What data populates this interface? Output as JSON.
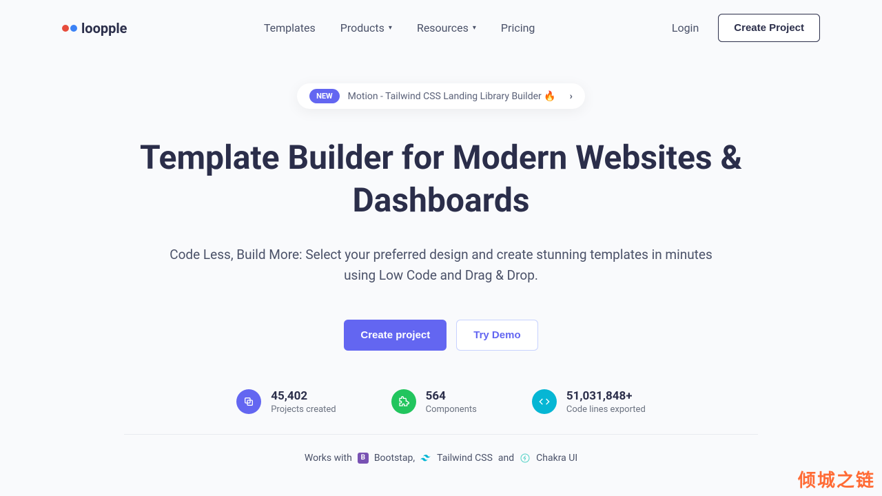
{
  "brand": "loopple",
  "nav": {
    "items": [
      "Templates",
      "Products",
      "Resources",
      "Pricing"
    ],
    "login": "Login",
    "cta": "Create Project"
  },
  "pill": {
    "badge": "NEW",
    "text": "Motion - Tailwind CSS Landing Library Builder 🔥"
  },
  "headline": "Template Builder for Modern Websites & Dashboards",
  "subheadline": "Code Less, Build More: Select your preferred design and create stunning templates in minutes using Low Code and Drag & Drop.",
  "cta": {
    "primary": "Create project",
    "secondary": "Try Demo"
  },
  "stats": [
    {
      "value": "45,402",
      "label": "Projects created"
    },
    {
      "value": "564",
      "label": "Components"
    },
    {
      "value": "51,031,848+",
      "label": "Code lines exported"
    }
  ],
  "works": {
    "prefix": "Works with",
    "items": [
      "Bootstap,",
      "Tailwind CSS",
      "Chakra UI"
    ],
    "joiner": "and"
  },
  "watermark": "倾城之链"
}
